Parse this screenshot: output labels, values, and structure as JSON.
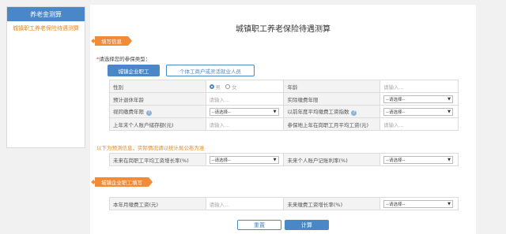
{
  "sidebar": {
    "header": "养老金测算",
    "items": [
      {
        "label": "城镇职工养老保险待遇测算"
      }
    ]
  },
  "page": {
    "title": "城镇职工养老保险待遇测算"
  },
  "section1": {
    "tag": "填写信息",
    "type_prompt": "请选择您的参保类型：",
    "types": [
      {
        "label": "城镇企业职工"
      },
      {
        "label": "个体工商户或灵活就业人员"
      }
    ]
  },
  "form1": {
    "gender_label": "性别",
    "gender_options": [
      "男",
      "女"
    ],
    "age_label": "年龄",
    "age_placeholder": "请输入...",
    "retire_age_label": "预计退休年龄",
    "retire_age_placeholder": "请输入...",
    "paid_years_label": "实际缴费年限",
    "paid_years_value": "--请选择--",
    "deemed_years_label": "视同缴费年限",
    "deemed_years_value": "--请选择--",
    "avg_index_label": "以前年度平均缴费工资指数",
    "avg_index_value": "--请选择--",
    "account_label": "上年末个人账户储存额(元)",
    "account_placeholder": "请输入...",
    "avg_wage_label": "参保地上年在岗职工月平均工资(元)",
    "avg_wage_placeholder": "请输入..."
  },
  "notice": "以下为预测信息，实际情况请以统计局公布为准",
  "form2": {
    "wage_growth_label": "未来在岗职工平均工资增长率(%)",
    "wage_growth_value": "--请选择--",
    "account_rate_label": "未来个人账户记账利率(%)",
    "account_rate_value": "--请选择--"
  },
  "section2": {
    "tag": "城镇企业职工填写"
  },
  "form3": {
    "monthly_wage_label": "本年月缴费工资(元)",
    "monthly_wage_placeholder": "请输入...",
    "future_growth_label": "未来缴费工资增长率(%)",
    "future_growth_value": "--请选择--"
  },
  "actions": {
    "reset": "重置",
    "calc": "计算"
  },
  "colors": {
    "primary": "#4a87c6",
    "accent": "#f08b3a",
    "notice": "#e48822"
  }
}
